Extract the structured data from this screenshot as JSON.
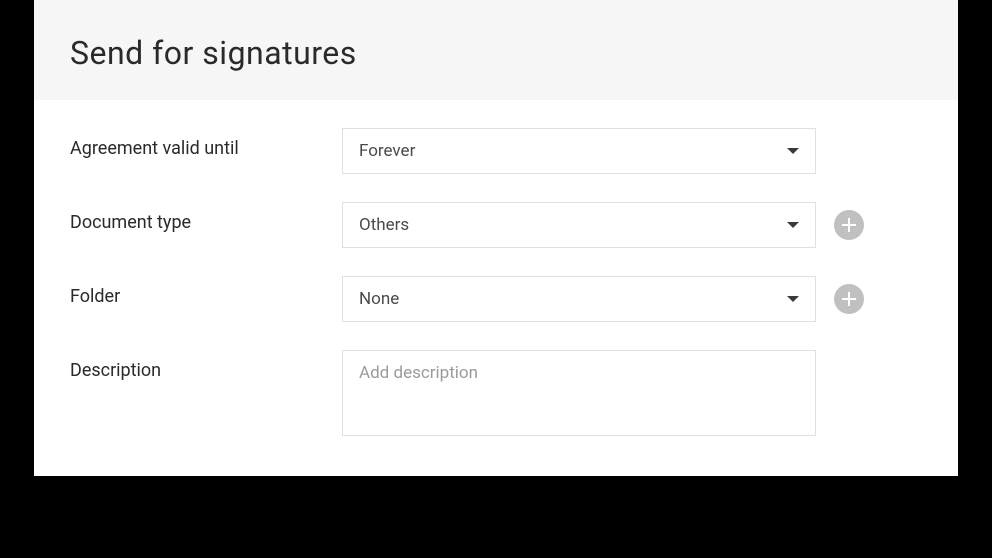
{
  "header": {
    "title": "Send for signatures"
  },
  "form": {
    "agreement_valid": {
      "label": "Agreement valid until",
      "value": "Forever"
    },
    "document_type": {
      "label": "Document type",
      "value": "Others"
    },
    "folder": {
      "label": "Folder",
      "value": "None"
    },
    "description": {
      "label": "Description",
      "placeholder": "Add description",
      "value": ""
    }
  }
}
